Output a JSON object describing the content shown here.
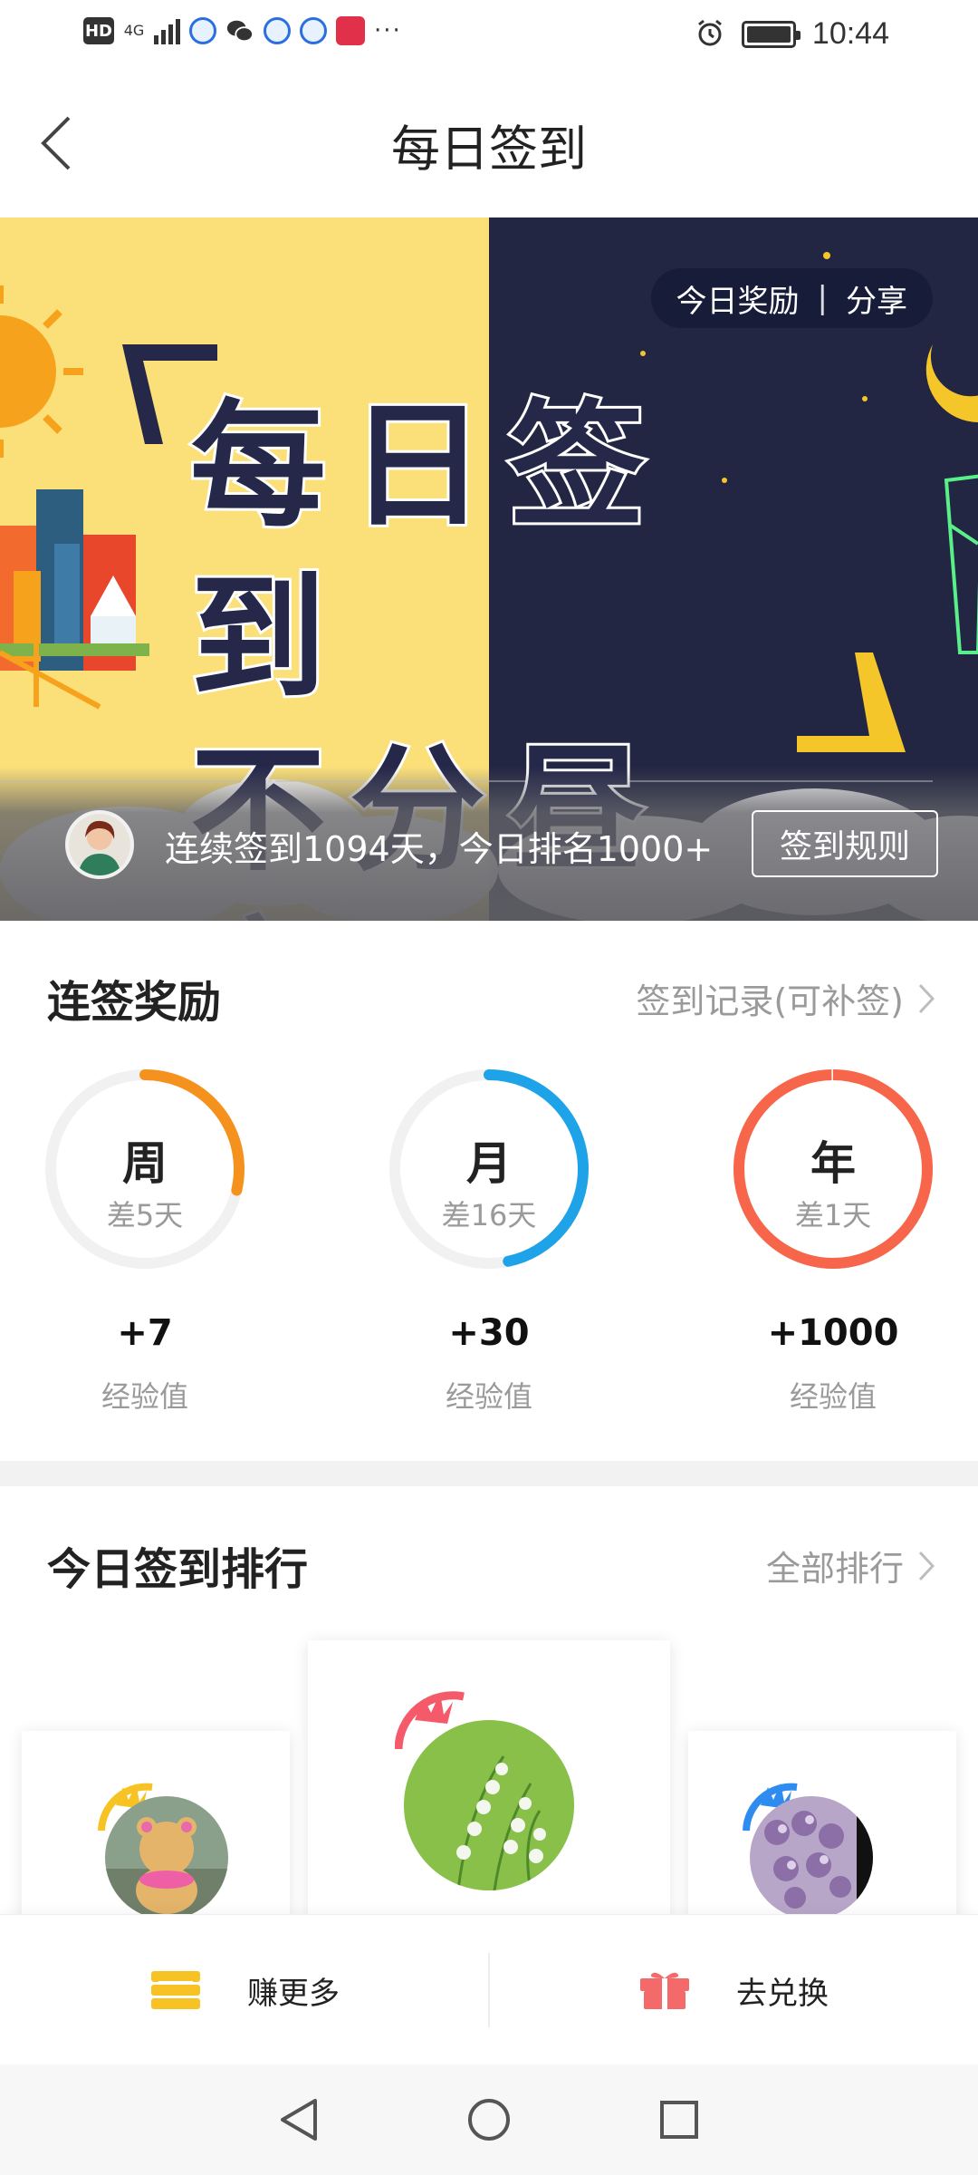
{
  "status_bar": {
    "hd": "HD",
    "network": "4G",
    "time": "10:44",
    "more": "···",
    "icons": [
      "hd-icon",
      "signal-icon",
      "app-icon",
      "wechat-icon",
      "app-icon",
      "app-icon",
      "book-app-icon",
      "alarm-icon",
      "battery-icon"
    ]
  },
  "header": {
    "title": "每日签到",
    "back_icon": "chevron-left-icon"
  },
  "banner": {
    "hero_line1": "每日签到",
    "hero_line2": "不分昼夜",
    "today_reward": "今日奖励",
    "separator": "|",
    "share": "分享",
    "streak_text": "连续签到1094天，今日排名1000+",
    "rules_button": "签到规则"
  },
  "streak_rewards": {
    "title": "连签奖励",
    "record_link": "签到记录(可补签)",
    "items": [
      {
        "unit": "周",
        "remaining": "差5天",
        "points": "+7",
        "points_label": "经验值",
        "progress": 0.286,
        "color": "#F5921E"
      },
      {
        "unit": "月",
        "remaining": "差16天",
        "points": "+30",
        "points_label": "经验值",
        "progress": 0.467,
        "color": "#1FA3E8"
      },
      {
        "unit": "年",
        "remaining": "差1天",
        "points": "+1000",
        "points_label": "经验值",
        "progress": 0.997,
        "color": "#F7664A"
      }
    ]
  },
  "ranking": {
    "title": "今日签到排行",
    "all_link": "全部排行"
  },
  "actions": {
    "earn_more": "赚更多",
    "redeem": "去兑换"
  },
  "colors": {
    "banner_yellow": "#FBE07A",
    "banner_navy": "#232642",
    "crown_first": "#F45A6A",
    "crown_second": "#F7C324",
    "crown_third": "#2E8CF0"
  }
}
